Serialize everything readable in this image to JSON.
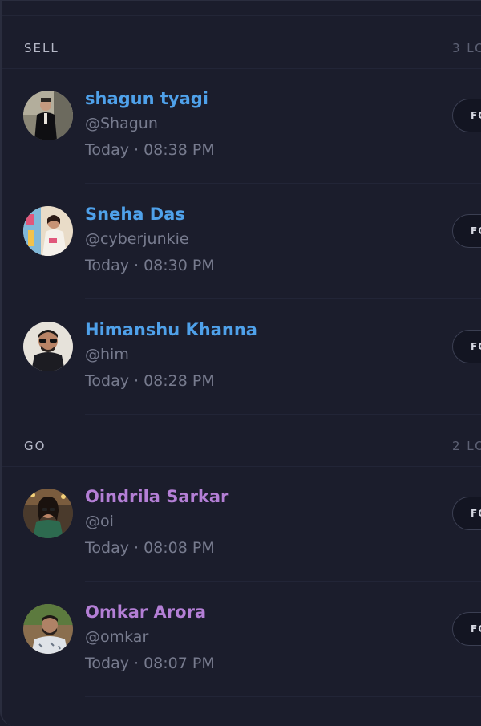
{
  "sections": [
    {
      "title": "SELL",
      "count": "3 LO",
      "rows": [
        {
          "name": "shagun tyagi",
          "handle": "@Shagun",
          "time": "Today · 08:38 PM",
          "button": "FO",
          "name_color": "#4fa1ea"
        },
        {
          "name": "Sneha Das",
          "handle": "@cyberjunkie",
          "time": "Today · 08:30 PM",
          "button": "FO",
          "name_color": "#4fa1ea"
        },
        {
          "name": "Himanshu Khanna",
          "handle": "@him",
          "time": "Today · 08:28 PM",
          "button": "FO",
          "name_color": "#4fa1ea"
        }
      ]
    },
    {
      "title": "GO",
      "count": "2 LO",
      "rows": [
        {
          "name": "Oindrila Sarkar",
          "handle": "@oi",
          "time": "Today · 08:08 PM",
          "button": "FO",
          "name_color": "#b47fd6"
        },
        {
          "name": "Omkar Arora",
          "handle": "@omkar",
          "time": "Today · 08:07 PM",
          "button": "FO",
          "name_color": "#b47fd6"
        }
      ]
    }
  ],
  "colors": {
    "background": "#1b1d2c",
    "sell_accent": "#4fa1ea",
    "go_accent": "#b47fd6",
    "muted_text": "#777b8e"
  }
}
